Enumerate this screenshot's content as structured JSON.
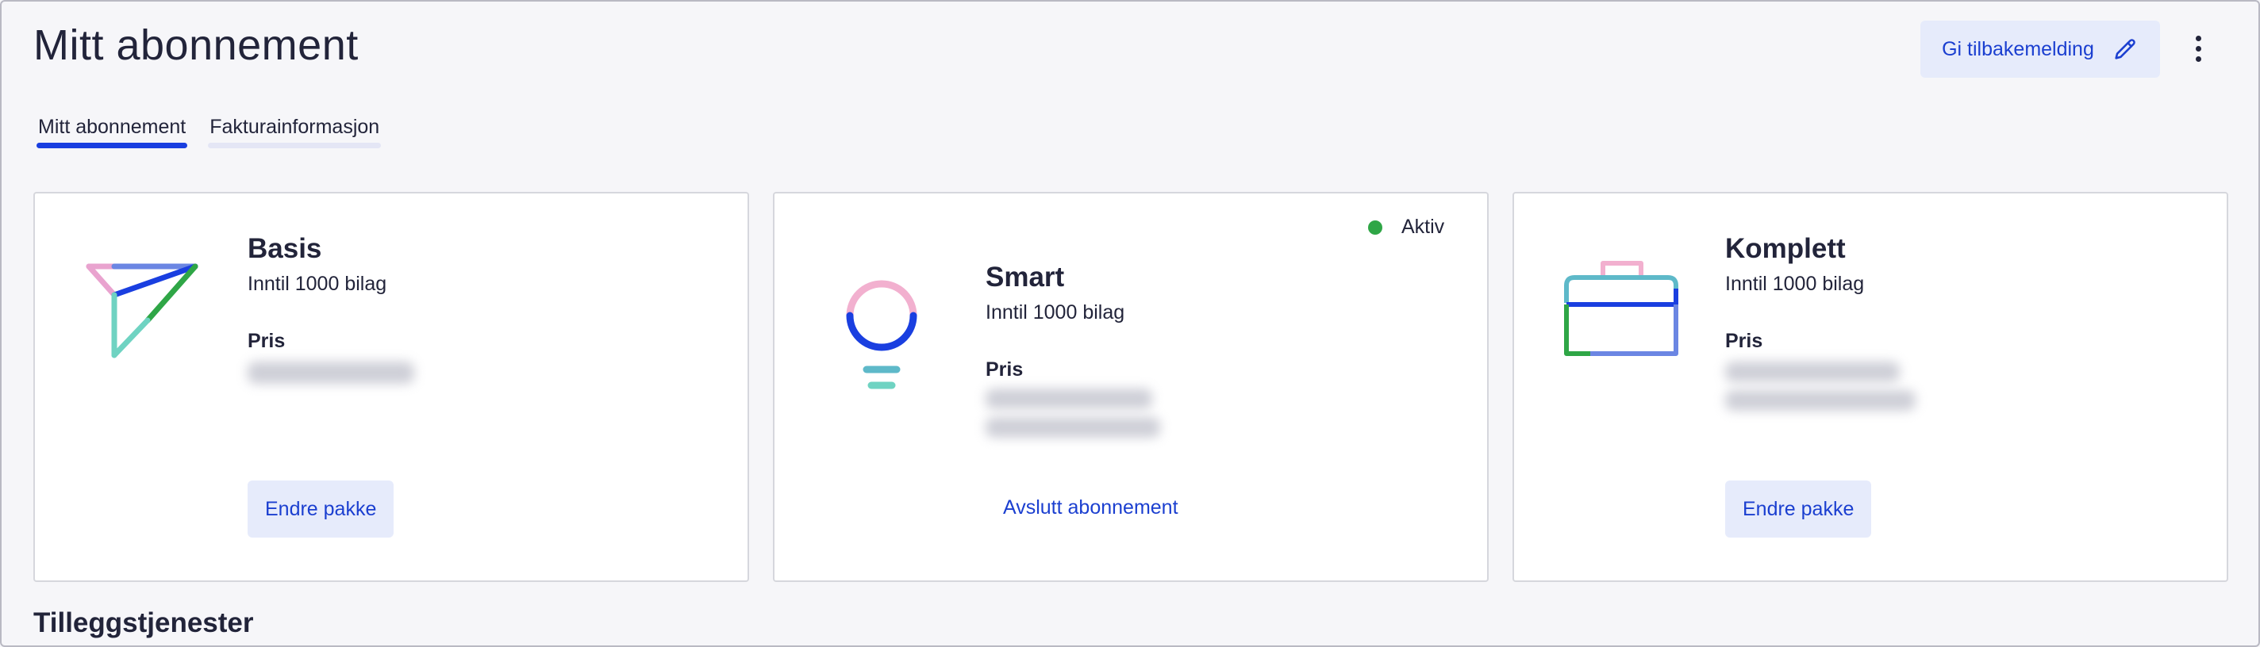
{
  "header": {
    "title": "Mitt abonnement",
    "feedback_label": "Gi tilbakemelding",
    "feedback_icon": "pencil-icon",
    "more_icon": "more-vertical-icon"
  },
  "tabs": [
    {
      "label": "Mitt abonnement",
      "active": true
    },
    {
      "label": "Fakturainformasjon",
      "active": false
    }
  ],
  "plans": [
    {
      "name": "Basis",
      "limit": "Inntil 1000 bilag",
      "price_label": "Pris",
      "icon": "paper-plane-icon",
      "action_label": "Endre pakke",
      "action_type": "button"
    },
    {
      "name": "Smart",
      "limit": "Inntil 1000 bilag",
      "price_label": "Pris",
      "icon": "lightbulb-icon",
      "status": "Aktiv",
      "action_label": "Avslutt abonnement",
      "action_type": "link"
    },
    {
      "name": "Komplett",
      "limit": "Inntil 1000 bilag",
      "price_label": "Pris",
      "icon": "briefcase-icon",
      "action_label": "Endre pakke",
      "action_type": "button"
    }
  ],
  "addons": {
    "title": "Tilleggstjenester"
  },
  "colors": {
    "accent": "#1a3fe0",
    "button_bg": "#e6ebfb",
    "status_active": "#2fa646",
    "background": "#f6f6f9"
  }
}
